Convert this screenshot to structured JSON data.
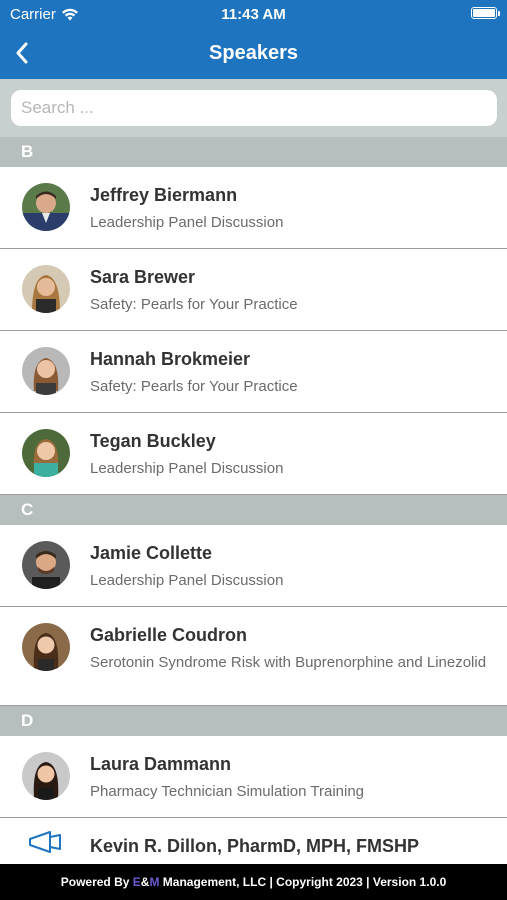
{
  "status_bar": {
    "carrier": "Carrier",
    "time": "11:43 AM"
  },
  "nav": {
    "title": "Speakers"
  },
  "search": {
    "placeholder": "Search ..."
  },
  "sections": [
    {
      "letter": "B",
      "speakers": [
        {
          "name": "Jeffrey Biermann",
          "session": "Leadership Panel Discussion"
        },
        {
          "name": "Sara Brewer",
          "session": "Safety: Pearls for Your Practice"
        },
        {
          "name": "Hannah Brokmeier",
          "session": "Safety: Pearls for Your Practice"
        },
        {
          "name": "Tegan Buckley",
          "session": "Leadership Panel Discussion"
        }
      ]
    },
    {
      "letter": "C",
      "speakers": [
        {
          "name": "Jamie Collette",
          "session": "Leadership Panel Discussion"
        },
        {
          "name": "Gabrielle Coudron",
          "session": "Serotonin Syndrome Risk with Buprenorphine and Linezolid"
        }
      ]
    },
    {
      "letter": "D",
      "speakers": [
        {
          "name": "Laura Dammann",
          "session": "Pharmacy Technician Simulation Training"
        },
        {
          "name": "Kevin R. Dillon, PharmD, MPH, FMSHP",
          "session": ""
        }
      ]
    }
  ],
  "footer": {
    "prefix": "Powered By ",
    "brand_e": "E",
    "brand_amp": "&",
    "brand_m": "M",
    "suffix": " Management, LLC | Copyright 2023 | Version 1.0.0"
  },
  "colors": {
    "header": "#1f74bf",
    "section_header": "#b6bfbe",
    "search_bar": "#c8cfcf",
    "footer": "#000000",
    "brand_accent": "#6a5acd"
  },
  "icons": {
    "back": "chevron-left-icon",
    "wifi": "wifi-icon",
    "battery": "battery-icon",
    "placeholder_avatar": "megaphone-icon"
  }
}
